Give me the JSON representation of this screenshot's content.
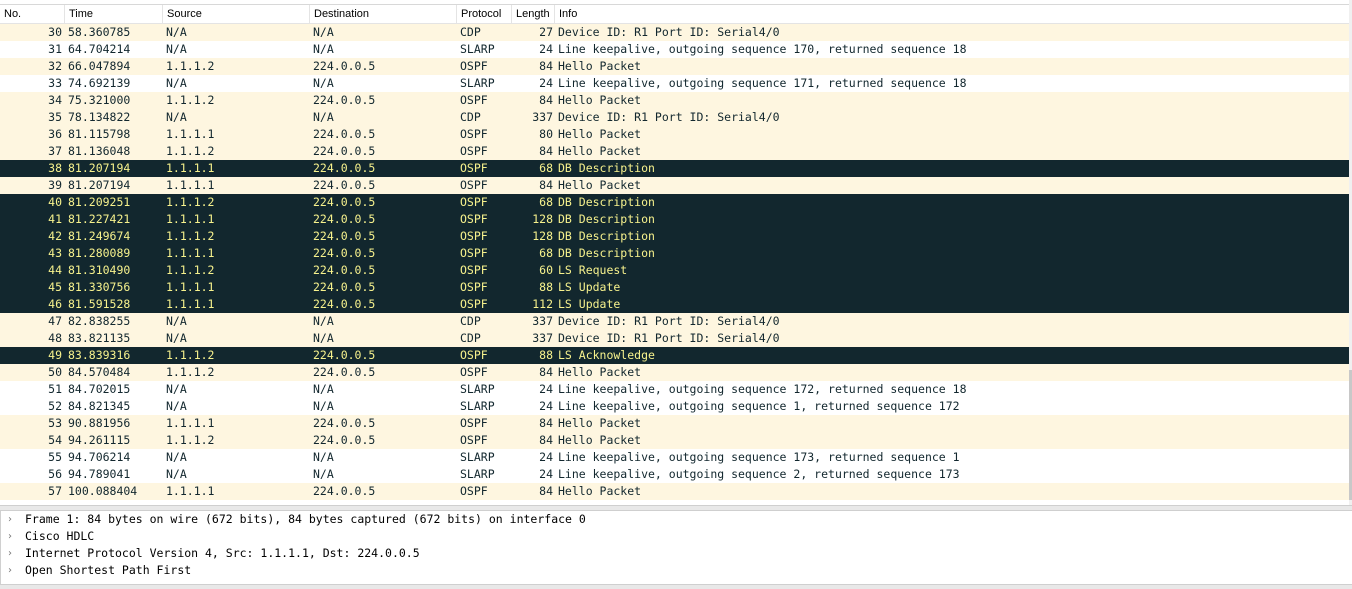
{
  "columns": {
    "no": "No.",
    "time": "Time",
    "source": "Source",
    "destination": "Destination",
    "protocol": "Protocol",
    "length": "Length",
    "info": "Info"
  },
  "packets": [
    {
      "no": "30",
      "time": "58.360785",
      "src": "N/A",
      "dst": "N/A",
      "proto": "CDP",
      "len": "27",
      "info": "Device ID: R1  Port ID: Serial4/0",
      "selected": false
    },
    {
      "no": "31",
      "time": "64.704214",
      "src": "N/A",
      "dst": "N/A",
      "proto": "SLARP",
      "len": "24",
      "info": "Line keepalive, outgoing sequence 170, returned sequence 18",
      "selected": false
    },
    {
      "no": "32",
      "time": "66.047894",
      "src": "1.1.1.2",
      "dst": "224.0.0.5",
      "proto": "OSPF",
      "len": "84",
      "info": "Hello Packet",
      "selected": false
    },
    {
      "no": "33",
      "time": "74.692139",
      "src": "N/A",
      "dst": "N/A",
      "proto": "SLARP",
      "len": "24",
      "info": "Line keepalive, outgoing sequence 171, returned sequence 18",
      "selected": false
    },
    {
      "no": "34",
      "time": "75.321000",
      "src": "1.1.1.2",
      "dst": "224.0.0.5",
      "proto": "OSPF",
      "len": "84",
      "info": "Hello Packet",
      "selected": false
    },
    {
      "no": "35",
      "time": "78.134822",
      "src": "N/A",
      "dst": "N/A",
      "proto": "CDP",
      "len": "337",
      "info": "Device ID: R1  Port ID: Serial4/0",
      "selected": false
    },
    {
      "no": "36",
      "time": "81.115798",
      "src": "1.1.1.1",
      "dst": "224.0.0.5",
      "proto": "OSPF",
      "len": "80",
      "info": "Hello Packet",
      "selected": false
    },
    {
      "no": "37",
      "time": "81.136048",
      "src": "1.1.1.2",
      "dst": "224.0.0.5",
      "proto": "OSPF",
      "len": "84",
      "info": "Hello Packet",
      "selected": false
    },
    {
      "no": "38",
      "time": "81.207194",
      "src": "1.1.1.1",
      "dst": "224.0.0.5",
      "proto": "OSPF",
      "len": "68",
      "info": "DB Description",
      "selected": true
    },
    {
      "no": "39",
      "time": "81.207194",
      "src": "1.1.1.1",
      "dst": "224.0.0.5",
      "proto": "OSPF",
      "len": "84",
      "info": "Hello Packet",
      "selected": false
    },
    {
      "no": "40",
      "time": "81.209251",
      "src": "1.1.1.2",
      "dst": "224.0.0.5",
      "proto": "OSPF",
      "len": "68",
      "info": "DB Description",
      "selected": true
    },
    {
      "no": "41",
      "time": "81.227421",
      "src": "1.1.1.1",
      "dst": "224.0.0.5",
      "proto": "OSPF",
      "len": "128",
      "info": "DB Description",
      "selected": true
    },
    {
      "no": "42",
      "time": "81.249674",
      "src": "1.1.1.2",
      "dst": "224.0.0.5",
      "proto": "OSPF",
      "len": "128",
      "info": "DB Description",
      "selected": true
    },
    {
      "no": "43",
      "time": "81.280089",
      "src": "1.1.1.1",
      "dst": "224.0.0.5",
      "proto": "OSPF",
      "len": "68",
      "info": "DB Description",
      "selected": true
    },
    {
      "no": "44",
      "time": "81.310490",
      "src": "1.1.1.2",
      "dst": "224.0.0.5",
      "proto": "OSPF",
      "len": "60",
      "info": "LS Request",
      "selected": true
    },
    {
      "no": "45",
      "time": "81.330756",
      "src": "1.1.1.1",
      "dst": "224.0.0.5",
      "proto": "OSPF",
      "len": "88",
      "info": "LS Update",
      "selected": true
    },
    {
      "no": "46",
      "time": "81.591528",
      "src": "1.1.1.1",
      "dst": "224.0.0.5",
      "proto": "OSPF",
      "len": "112",
      "info": "LS Update",
      "selected": true
    },
    {
      "no": "47",
      "time": "82.838255",
      "src": "N/A",
      "dst": "N/A",
      "proto": "CDP",
      "len": "337",
      "info": "Device ID: R1  Port ID: Serial4/0",
      "selected": false
    },
    {
      "no": "48",
      "time": "83.821135",
      "src": "N/A",
      "dst": "N/A",
      "proto": "CDP",
      "len": "337",
      "info": "Device ID: R1  Port ID: Serial4/0",
      "selected": false
    },
    {
      "no": "49",
      "time": "83.839316",
      "src": "1.1.1.2",
      "dst": "224.0.0.5",
      "proto": "OSPF",
      "len": "88",
      "info": "LS Acknowledge",
      "selected": true
    },
    {
      "no": "50",
      "time": "84.570484",
      "src": "1.1.1.2",
      "dst": "224.0.0.5",
      "proto": "OSPF",
      "len": "84",
      "info": "Hello Packet",
      "selected": false
    },
    {
      "no": "51",
      "time": "84.702015",
      "src": "N/A",
      "dst": "N/A",
      "proto": "SLARP",
      "len": "24",
      "info": "Line keepalive, outgoing sequence 172, returned sequence 18",
      "selected": false
    },
    {
      "no": "52",
      "time": "84.821345",
      "src": "N/A",
      "dst": "N/A",
      "proto": "SLARP",
      "len": "24",
      "info": "Line keepalive, outgoing sequence 1, returned sequence 172",
      "selected": false
    },
    {
      "no": "53",
      "time": "90.881956",
      "src": "1.1.1.1",
      "dst": "224.0.0.5",
      "proto": "OSPF",
      "len": "84",
      "info": "Hello Packet",
      "selected": false
    },
    {
      "no": "54",
      "time": "94.261115",
      "src": "1.1.1.2",
      "dst": "224.0.0.5",
      "proto": "OSPF",
      "len": "84",
      "info": "Hello Packet",
      "selected": false
    },
    {
      "no": "55",
      "time": "94.706214",
      "src": "N/A",
      "dst": "N/A",
      "proto": "SLARP",
      "len": "24",
      "info": "Line keepalive, outgoing sequence 173, returned sequence 1",
      "selected": false
    },
    {
      "no": "56",
      "time": "94.789041",
      "src": "N/A",
      "dst": "N/A",
      "proto": "SLARP",
      "len": "24",
      "info": "Line keepalive, outgoing sequence 2, returned sequence 173",
      "selected": false
    },
    {
      "no": "57",
      "time": "100.088404",
      "src": "1.1.1.1",
      "dst": "224.0.0.5",
      "proto": "OSPF",
      "len": "84",
      "info": "Hello Packet",
      "selected": false
    }
  ],
  "details": [
    {
      "expander": "›",
      "text": "Frame 1: 84 bytes on wire (672 bits), 84 bytes captured (672 bits) on interface 0"
    },
    {
      "expander": "›",
      "text": "Cisco HDLC"
    },
    {
      "expander": "›",
      "text": "Internet Protocol Version 4, Src: 1.1.1.1, Dst: 224.0.0.5"
    },
    {
      "expander": "›",
      "text": "Open Shortest Path First"
    }
  ],
  "colors": {
    "row_cdp_ospf": "#fef6e0",
    "row_slarp": "#ffffff",
    "row_selected_bg": "#12272e",
    "row_selected_fg": "#f7f28d",
    "text_default": "#12272e"
  }
}
